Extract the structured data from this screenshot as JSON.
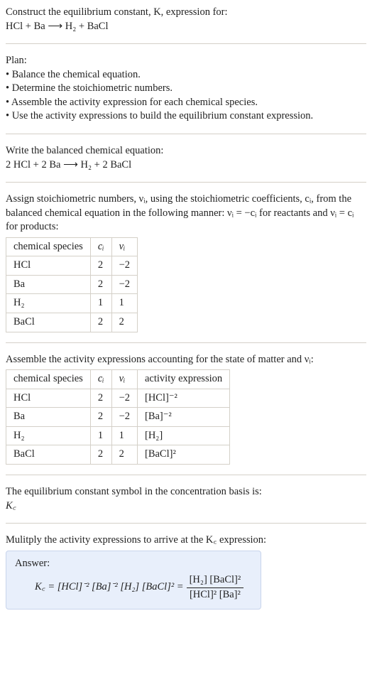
{
  "header": {
    "line1": "Construct the equilibrium constant, K, expression for:",
    "equation": "HCl + Ba ⟶ H₂ + BaCl"
  },
  "plan": {
    "title": "Plan:",
    "items": [
      "• Balance the chemical equation.",
      "• Determine the stoichiometric numbers.",
      "• Assemble the activity expression for each chemical species.",
      "• Use the activity expressions to build the equilibrium constant expression."
    ]
  },
  "balanced": {
    "title": "Write the balanced chemical equation:",
    "equation": "2 HCl + 2 Ba ⟶ H₂ + 2 BaCl"
  },
  "stoich": {
    "intro": "Assign stoichiometric numbers, νᵢ, using the stoichiometric coefficients, cᵢ, from the balanced chemical equation in the following manner: νᵢ = −cᵢ for reactants and νᵢ = cᵢ for products:",
    "headers": {
      "species": "chemical species",
      "c": "cᵢ",
      "v": "νᵢ"
    },
    "rows": [
      {
        "species": "HCl",
        "c": "2",
        "v": "−2"
      },
      {
        "species": "Ba",
        "c": "2",
        "v": "−2"
      },
      {
        "species": "H₂",
        "c": "1",
        "v": "1"
      },
      {
        "species": "BaCl",
        "c": "2",
        "v": "2"
      }
    ]
  },
  "activity": {
    "intro": "Assemble the activity expressions accounting for the state of matter and νᵢ:",
    "headers": {
      "species": "chemical species",
      "c": "cᵢ",
      "v": "νᵢ",
      "act": "activity expression"
    },
    "rows": [
      {
        "species": "HCl",
        "c": "2",
        "v": "−2",
        "act": "[HCl]⁻²"
      },
      {
        "species": "Ba",
        "c": "2",
        "v": "−2",
        "act": "[Ba]⁻²"
      },
      {
        "species": "H₂",
        "c": "1",
        "v": "1",
        "act": "[H₂]"
      },
      {
        "species": "BaCl",
        "c": "2",
        "v": "2",
        "act": "[BaCl]²"
      }
    ]
  },
  "Ksymbol": {
    "title": "The equilibrium constant symbol in the concentration basis is:",
    "symbol": "K꜀"
  },
  "multiply": {
    "title": "Mulitply the activity expressions to arrive at the K꜀ expression:"
  },
  "answer": {
    "label": "Answer:",
    "lhs": "K꜀ = [HCl]⁻² [Ba]⁻² [H₂] [BaCl]² = ",
    "frac_num": "[H₂] [BaCl]²",
    "frac_den": "[HCl]² [Ba]²"
  }
}
